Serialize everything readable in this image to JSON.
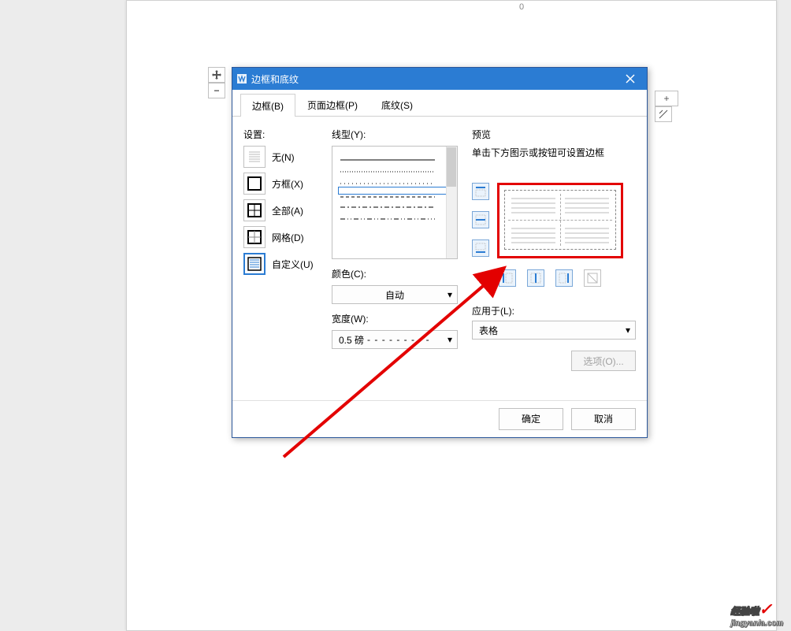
{
  "page_number": "0",
  "dialog": {
    "title": "边框和底纹",
    "tabs": {
      "border": "边框(B)",
      "page_border": "页面边框(P)",
      "shading": "底纹(S)"
    },
    "settings": {
      "label": "设置:",
      "none": "无(N)",
      "box": "方框(X)",
      "all": "全部(A)",
      "grid": "网格(D)",
      "custom": "自定义(U)"
    },
    "style": {
      "label": "线型(Y):",
      "color_label": "颜色(C):",
      "color_value": "自动",
      "width_label": "宽度(W):",
      "width_value": "0.5  磅",
      "width_dashes": "- - - - - - - - -"
    },
    "preview": {
      "label": "预览",
      "hint": "单击下方图示或按钮可设置边框"
    },
    "apply_to": {
      "label": "应用于(L):",
      "value": "表格"
    },
    "options_btn": "选项(O)...",
    "ok": "确定",
    "cancel": "取消"
  },
  "watermark": {
    "main": "经验啦",
    "sub": "jingyanla.com"
  }
}
